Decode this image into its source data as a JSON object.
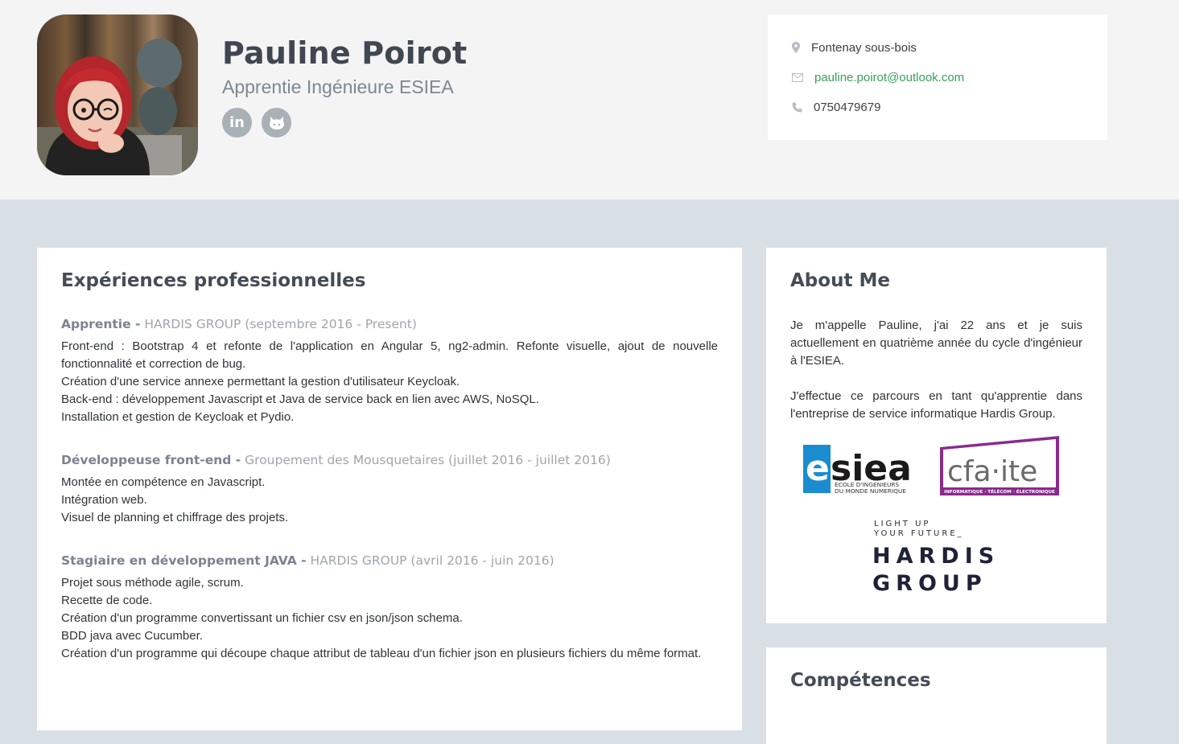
{
  "profile": {
    "name": "Pauline Poirot",
    "tagline": "Apprentie Ingénieure ESIEA",
    "social": [
      {
        "name": "linkedin",
        "glyph": "in"
      },
      {
        "name": "github",
        "glyph": ""
      }
    ]
  },
  "contact": {
    "location": "Fontenay sous-bois",
    "email": "pauline.poirot@outlook.com",
    "phone": "0750479679"
  },
  "experience": {
    "title": "Expériences professionnelles",
    "jobs": [
      {
        "role": "Apprentie -",
        "org": "HARDIS GROUP (septembre 2016 - Present)",
        "lines": [
          "Front-end : Bootstrap 4 et refonte de l'application en Angular 5, ng2-admin. Refonte visuelle, ajout de nouvelle fonctionnalité et correction de bug.",
          "Création d'une service annexe permettant la gestion d'utilisateur Keycloak.",
          "Back-end : développement Javascript et Java de service back en lien avec AWS, NoSQL.",
          "Installation et gestion de Keycloak et Pydio."
        ]
      },
      {
        "role": "Développeuse front-end -",
        "org": "Groupement des Mousquetaires (juillet 2016 - juillet 2016)",
        "lines": [
          "Montée en compétence en Javascript.",
          "Intégration web.",
          "Visuel de planning et chiffrage des projets."
        ]
      },
      {
        "role": "Stagiaire en développement JAVA -",
        "org": "HARDIS GROUP (avril 2016 - juin 2016)",
        "lines": [
          "Projet sous méthode agile, scrum.",
          "Recette de code.",
          "Création d'un programme convertissant un fichier csv en json/json schema.",
          "BDD java avec Cucumber.",
          "Création d'un programme qui découpe chaque attribut de tableau d'un fichier json en plusieurs fichiers du même format."
        ]
      }
    ]
  },
  "about": {
    "title": "About Me",
    "paragraphs": [
      "Je m'appelle Pauline, j'ai 22 ans et je suis actuellement en quatrième année du cycle d'ingénieur à l'ESIEA.",
      "J'effectue ce parcours en tant qu'apprentie dans l'entreprise de service informatique Hardis Group."
    ],
    "logos": {
      "esiea": {
        "word": "esiea",
        "sub1": "ECOLE D'INGENIEURS",
        "sub2": "DU MONDE NUMERIQUE"
      },
      "cfa": {
        "word": "cfa·ite",
        "sub": "INFORMATIQUE · TÉLÉCOM · ÉLECTRONIQUE"
      },
      "hardis": {
        "line1": "LIGHT UP",
        "line2": "YOUR FUTURE_",
        "line3": "HARDIS",
        "line4": "GROUP"
      }
    }
  },
  "skills": {
    "title": "Compétences"
  },
  "colors": {
    "accent_link": "#3aa05a",
    "header_bg": "#f4f4f4",
    "page_bg": "#d8e0e6",
    "esiea_blue": "#1a8cd0",
    "cfa_purple": "#8a2a8c"
  }
}
